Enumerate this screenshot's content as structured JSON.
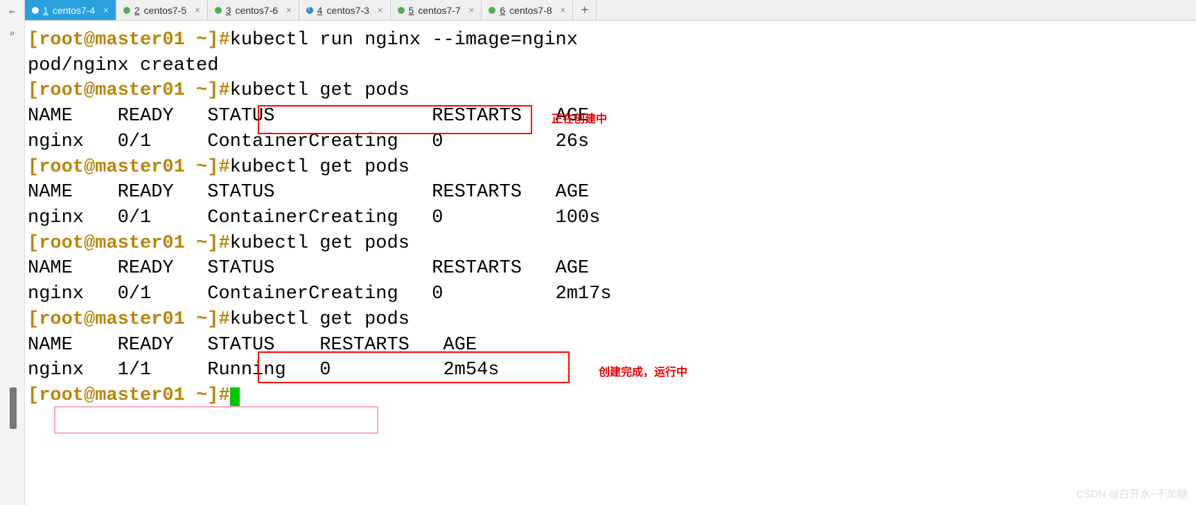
{
  "tabs": [
    {
      "num": "1",
      "label": "centos7-4",
      "active": true,
      "dot": "green"
    },
    {
      "num": "2",
      "label": "centos7-5",
      "active": false,
      "dot": "green"
    },
    {
      "num": "3",
      "label": "centos7-6",
      "active": false,
      "dot": "green"
    },
    {
      "num": "4",
      "label": "centos7-3",
      "active": false,
      "dot": "blue"
    },
    {
      "num": "5",
      "label": "centos7-7",
      "active": false,
      "dot": "green"
    },
    {
      "num": "6",
      "label": "centos7-8",
      "active": false,
      "dot": "green"
    }
  ],
  "add_tab": "+",
  "close_x": "×",
  "left_icons": {
    "back": "←",
    "search": "⌕"
  },
  "prompt": "[root@master01 ~]#",
  "cmds": {
    "run": "kubectl run nginx --image=nginx",
    "get": "kubectl get pods"
  },
  "output": {
    "created": "pod/nginx created",
    "hdr1": "NAME    READY   STATUS              RESTARTS   AGE",
    "r1": "nginx   0/1     ContainerCreating   0          26s",
    "r2": "nginx   0/1     ContainerCreating   0          100s",
    "r3": "nginx   0/1     ContainerCreating   0          2m17s",
    "hdr2": "NAME    READY   STATUS    RESTARTS   AGE",
    "r4": "nginx   1/1     Running   0          2m54s"
  },
  "annotations": {
    "creating": "正在创建中",
    "running": "创建完成，运行中"
  },
  "watermark": "CSDN @白开水~不加糖"
}
